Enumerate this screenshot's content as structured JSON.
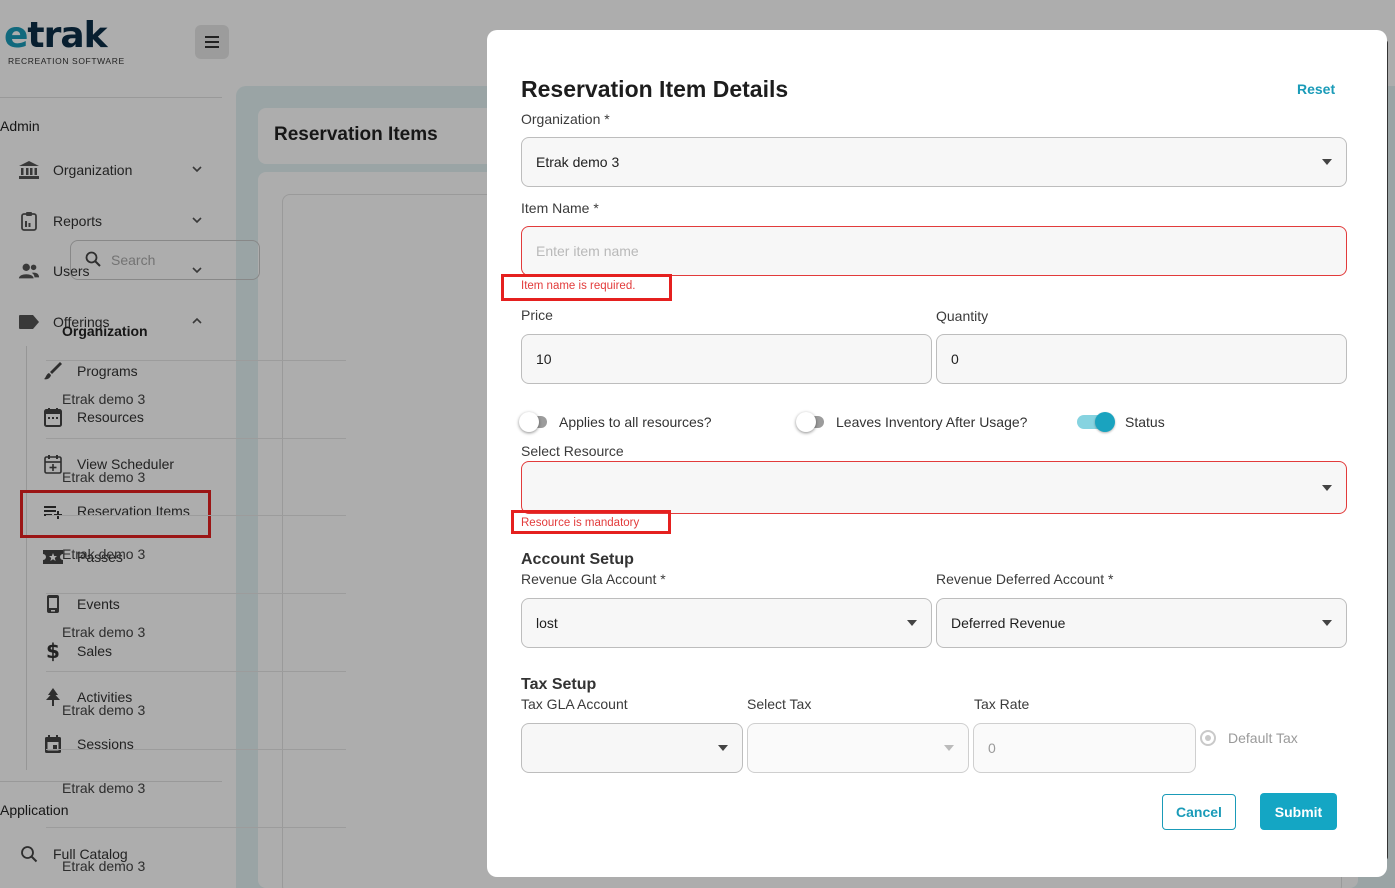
{
  "logo": {
    "word_e": "e",
    "word_rest": "trak",
    "subtitle": "RECREATION SOFTWARE"
  },
  "sidebar": {
    "admin_label": "Admin",
    "items": [
      {
        "label": "Organization",
        "icon": "bank-icon"
      },
      {
        "label": "Reports",
        "icon": "clipboard-icon"
      },
      {
        "label": "Users",
        "icon": "users-icon"
      },
      {
        "label": "Offerings",
        "icon": "tag-icon"
      }
    ],
    "sub_items": [
      {
        "label": "Programs",
        "icon": "brush-icon"
      },
      {
        "label": "Resources",
        "icon": "calendar-icon"
      },
      {
        "label": "View Scheduler",
        "icon": "calendar-add-icon"
      },
      {
        "label": "Reservation Items",
        "icon": "playlist-add-icon"
      },
      {
        "label": "Passes",
        "icon": "ticket-icon"
      },
      {
        "label": "Events",
        "icon": "phone-icon"
      },
      {
        "label": "Sales",
        "icon": "dollar-icon"
      },
      {
        "label": "Activities",
        "icon": "tree-icon"
      },
      {
        "label": "Sessions",
        "icon": "calendar-icon"
      }
    ],
    "application_label": "Application",
    "full_catalog": "Full Catalog"
  },
  "page": {
    "title": "Reservation Items",
    "search_placeholder": "Search",
    "column_organization": "Organization",
    "rows": [
      "Etrak demo 3",
      "Etrak demo 3",
      "Etrak demo 3",
      "Etrak demo 3",
      "Etrak demo 3",
      "Etrak demo 3",
      "Etrak demo 3"
    ]
  },
  "modal": {
    "title": "Reservation Item Details",
    "reset": "Reset",
    "organization_label": "Organization *",
    "organization_value": "Etrak demo 3",
    "item_name_label": "Item Name *",
    "item_name_placeholder": "Enter item name",
    "item_name_error": "Item name is required.",
    "price_label": "Price",
    "price_value": "10",
    "quantity_label": "Quantity",
    "quantity_value": "0",
    "toggle_applies": "Applies to all resources?",
    "toggle_leaves": "Leaves Inventory After Usage?",
    "toggle_status": "Status",
    "select_resource_label": "Select Resource",
    "resource_error": "Resource is mandatory",
    "account_setup": "Account Setup",
    "revenue_gla_label": "Revenue Gla Account *",
    "revenue_gla_value": "lost",
    "revenue_deferred_label": "Revenue Deferred Account *",
    "revenue_deferred_value": "Deferred Revenue",
    "tax_setup": "Tax Setup",
    "tax_gla_label": "Tax GLA Account",
    "select_tax_label": "Select Tax",
    "tax_rate_label": "Tax Rate",
    "tax_rate_value": "0",
    "default_tax": "Default Tax",
    "cancel": "Cancel",
    "submit": "Submit"
  },
  "colors": {
    "accent": "#1a9bb8",
    "error": "#e23b3b",
    "highlight": "#e5201f"
  }
}
